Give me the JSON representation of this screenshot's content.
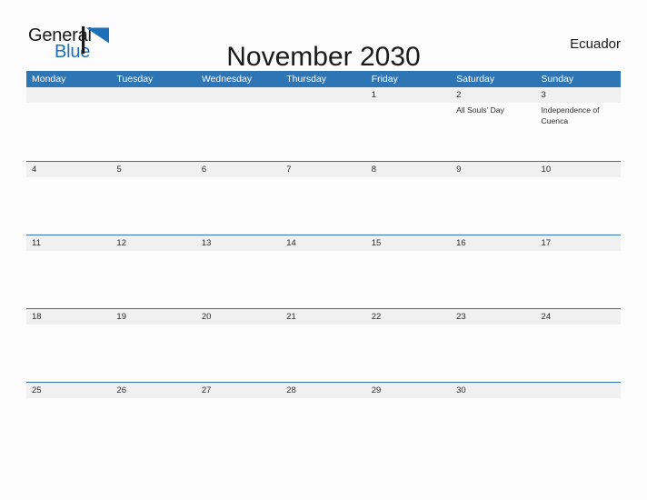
{
  "brand": {
    "name_part1": "General",
    "name_part2": "Blue",
    "flag_icon": "flag-triangle-icon",
    "accent_color": "#1d6fb8"
  },
  "header": {
    "title": "November 2030",
    "region": "Ecuador"
  },
  "theme": {
    "header_blue": "#2e75b6",
    "date_band_gray": "#f0f0f0",
    "page_background": "#fcfcfc",
    "text_color": "#2b2b2b"
  },
  "calendar": {
    "weekdays": [
      "Monday",
      "Tuesday",
      "Wednesday",
      "Thursday",
      "Friday",
      "Saturday",
      "Sunday"
    ],
    "weeks": [
      {
        "days": [
          {
            "date": "",
            "event": ""
          },
          {
            "date": "",
            "event": ""
          },
          {
            "date": "",
            "event": ""
          },
          {
            "date": "",
            "event": ""
          },
          {
            "date": "1",
            "event": ""
          },
          {
            "date": "2",
            "event": "All Souls' Day"
          },
          {
            "date": "3",
            "event": "Independence of Cuenca"
          }
        ]
      },
      {
        "days": [
          {
            "date": "4",
            "event": ""
          },
          {
            "date": "5",
            "event": ""
          },
          {
            "date": "6",
            "event": ""
          },
          {
            "date": "7",
            "event": ""
          },
          {
            "date": "8",
            "event": ""
          },
          {
            "date": "9",
            "event": ""
          },
          {
            "date": "10",
            "event": ""
          }
        ]
      },
      {
        "days": [
          {
            "date": "11",
            "event": ""
          },
          {
            "date": "12",
            "event": ""
          },
          {
            "date": "13",
            "event": ""
          },
          {
            "date": "14",
            "event": ""
          },
          {
            "date": "15",
            "event": ""
          },
          {
            "date": "16",
            "event": ""
          },
          {
            "date": "17",
            "event": ""
          }
        ]
      },
      {
        "days": [
          {
            "date": "18",
            "event": ""
          },
          {
            "date": "19",
            "event": ""
          },
          {
            "date": "20",
            "event": ""
          },
          {
            "date": "21",
            "event": ""
          },
          {
            "date": "22",
            "event": ""
          },
          {
            "date": "23",
            "event": ""
          },
          {
            "date": "24",
            "event": ""
          }
        ]
      },
      {
        "days": [
          {
            "date": "25",
            "event": ""
          },
          {
            "date": "26",
            "event": ""
          },
          {
            "date": "27",
            "event": ""
          },
          {
            "date": "28",
            "event": ""
          },
          {
            "date": "29",
            "event": ""
          },
          {
            "date": "30",
            "event": ""
          },
          {
            "date": "",
            "event": ""
          }
        ]
      }
    ]
  }
}
